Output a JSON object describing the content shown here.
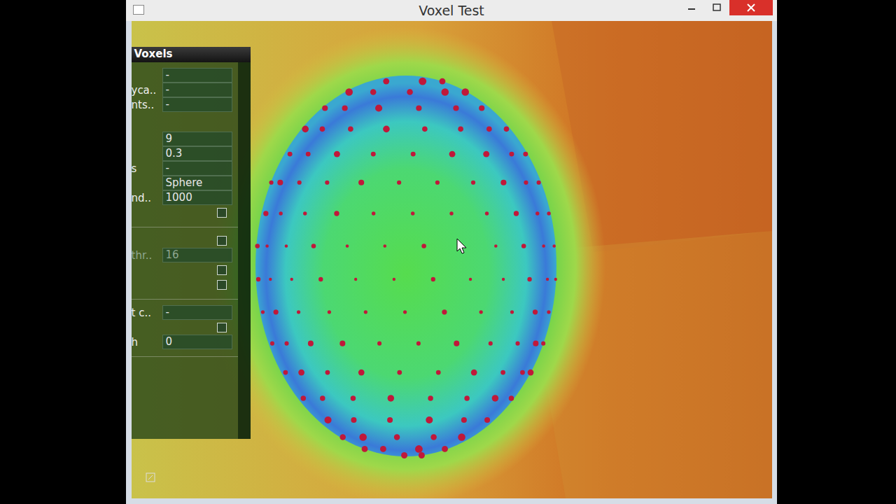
{
  "window": {
    "title": "Voxel Test"
  },
  "panel": {
    "title": "Voxels",
    "groups": [
      {
        "rows": [
          {
            "kind": "field",
            "value": "-",
            "disabled": false
          },
          {
            "kind": "field",
            "label": "yca..",
            "value": "-",
            "disabled": false
          },
          {
            "kind": "field",
            "label": "nts..",
            "value": "-",
            "disabled": false
          }
        ]
      },
      {
        "rows": [
          {
            "kind": "field",
            "value": "9",
            "disabled": false
          },
          {
            "kind": "field",
            "value": "0.3",
            "disabled": false
          },
          {
            "kind": "field",
            "label": "s",
            "value": "-",
            "disabled": false
          },
          {
            "kind": "field",
            "value": "Sphere",
            "disabled": false
          },
          {
            "kind": "field",
            "label": "nd..",
            "value": "1000",
            "disabled": false
          },
          {
            "kind": "checkbox",
            "checked": false,
            "disabled": false
          }
        ]
      },
      {
        "rows": [
          {
            "kind": "checkbox",
            "checked": false,
            "disabled": false
          },
          {
            "kind": "field",
            "label": "thr..",
            "value": "16",
            "disabled": true
          },
          {
            "kind": "checkbox",
            "checked": false,
            "disabled": false
          },
          {
            "kind": "checkbox",
            "checked": false,
            "disabled": false
          }
        ]
      },
      {
        "rows": [
          {
            "kind": "field",
            "label": "t c..",
            "value": "-",
            "disabled": false
          },
          {
            "kind": "checkbox",
            "checked": false,
            "disabled": false
          },
          {
            "kind": "field",
            "label": "h",
            "value": "0",
            "disabled": false
          }
        ]
      }
    ]
  }
}
